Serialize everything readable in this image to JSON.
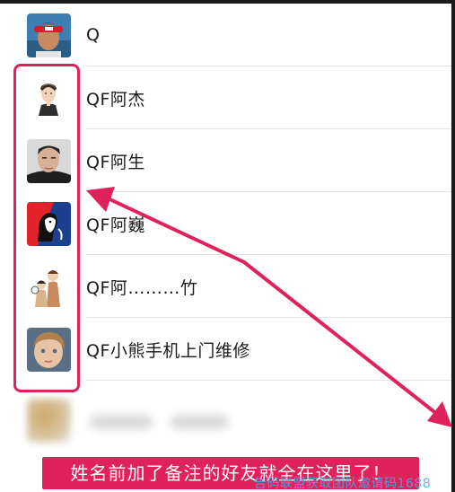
{
  "contacts": [
    {
      "name": "Q",
      "avatar": "man-red-cap-avatar"
    },
    {
      "name": "QF阿杰",
      "avatar": "cartoon-man-avatar"
    },
    {
      "name": "QF阿生",
      "avatar": "man-photo-avatar"
    },
    {
      "name": "QF阿巍",
      "avatar": "poster-art-avatar"
    },
    {
      "name": "QF阿………竹",
      "avatar": "cartoon-couple-avatar"
    },
    {
      "name": "QF小熊手机上门维修",
      "avatar": "child-photo-avatar"
    }
  ],
  "caption": "姓名前加了备注的好友就全在这里了！",
  "watermark": "告码联盟获取团队邀请码1688",
  "colors": {
    "accent": "#e0225b",
    "divider": "#e5e5e5",
    "watermark": "#4aa7e8"
  }
}
